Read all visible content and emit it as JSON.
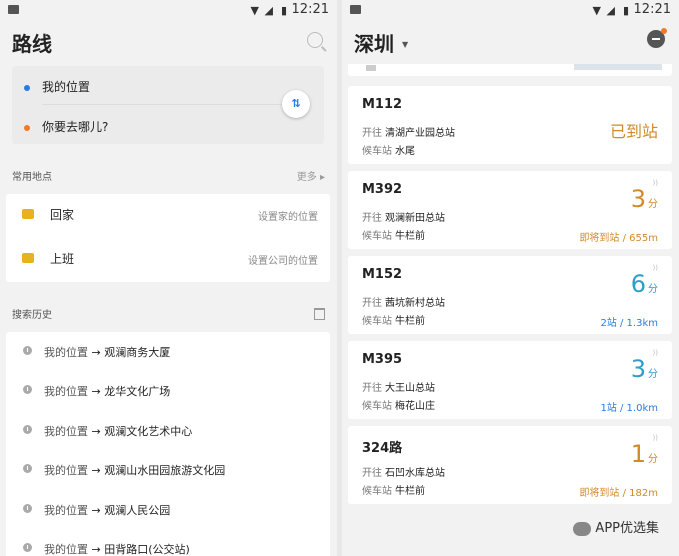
{
  "status_left": {
    "time": "12:21"
  },
  "status_right": {
    "time": "12:21"
  },
  "left": {
    "title": "路线",
    "route": {
      "from": "我的位置",
      "to": "你要去哪儿?"
    },
    "common": {
      "title": "常用地点",
      "more": "更多",
      "items": [
        {
          "label": "回家",
          "hint": "设置家的位置",
          "icon": "home-icon"
        },
        {
          "label": "上班",
          "hint": "设置公司的位置",
          "icon": "briefcase-icon"
        }
      ]
    },
    "history": {
      "title": "搜索历史",
      "items": [
        {
          "from": "我的位置",
          "arrow": "→",
          "to": "观澜商务大厦"
        },
        {
          "from": "我的位置",
          "arrow": "→",
          "to": "龙华文化广场"
        },
        {
          "from": "我的位置",
          "arrow": "→",
          "to": "观澜文化艺术中心"
        },
        {
          "from": "我的位置",
          "arrow": "→",
          "to": "观澜山水田园旅游文化园"
        },
        {
          "from": "我的位置",
          "arrow": "→",
          "to": "观澜人民公园"
        },
        {
          "from": "我的位置",
          "arrow": "→",
          "to": "田背路口(公交站)"
        }
      ]
    }
  },
  "right": {
    "city": "深圳",
    "buses": [
      {
        "route": "M112",
        "to_prefix": "开往",
        "to": "清湖产业园总站",
        "stop_prefix": "候车站",
        "stop": "水尾",
        "arrived": "已到站"
      },
      {
        "route": "M392",
        "to_prefix": "开往",
        "to": "观澜新田总站",
        "stop_prefix": "候车站",
        "stop": "牛栏前",
        "minutes": "3",
        "unit": "分",
        "dist": "即将到站 / 655m",
        "color": "#d08a2a"
      },
      {
        "route": "M152",
        "to_prefix": "开往",
        "to": "茜坑新村总站",
        "stop_prefix": "候车站",
        "stop": "牛栏前",
        "minutes": "6",
        "unit": "分",
        "dist": "2站 / 1.3km",
        "color": "#2aa0c7"
      },
      {
        "route": "M395",
        "to_prefix": "开往",
        "to": "大王山总站",
        "stop_prefix": "候车站",
        "stop": "梅花山庄",
        "minutes": "3",
        "unit": "分",
        "dist": "1站 / 1.0km",
        "color": "#2aa0c7"
      },
      {
        "route": "324路",
        "to_prefix": "开往",
        "to": "石凹水库总站",
        "stop_prefix": "候车站",
        "stop": "牛栏前",
        "minutes": "1",
        "unit": "分",
        "dist": "即将到站 / 182m",
        "color": "#d08a2a"
      }
    ]
  },
  "watermark": "APP优选集"
}
